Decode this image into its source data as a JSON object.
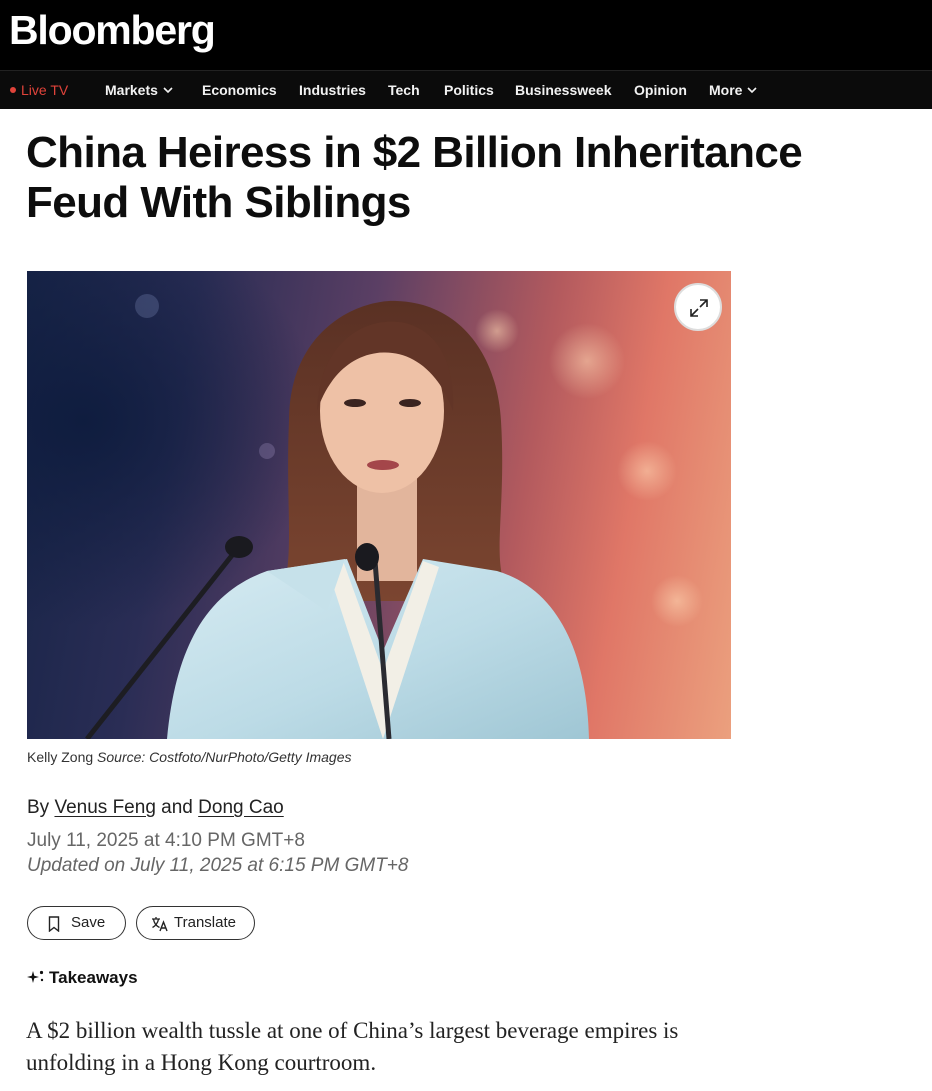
{
  "header": {
    "logo": "Bloomberg"
  },
  "nav": {
    "live": "Live TV",
    "items": [
      "Markets",
      "Economics",
      "Industries",
      "Tech",
      "Politics",
      "Businessweek",
      "Opinion",
      "More"
    ]
  },
  "article": {
    "headline_line1": "China Heiress in $2 Billion Inheritance",
    "headline_line2": "Feud With Siblings",
    "image": {
      "caption_name": "Kelly Zong",
      "caption_source": "Source: Costfoto/NurPhoto/Getty Images",
      "expand_icon": "expand-icon"
    },
    "byline": {
      "prefix": "By",
      "author1": "Venus Feng",
      "conjunction": "and",
      "author2": "Dong Cao"
    },
    "published": "July 11, 2025 at 4:10 PM GMT+8",
    "updated": "Updated on July 11, 2025 at 6:15 PM GMT+8",
    "actions": {
      "save": "Save",
      "translate": "Translate"
    },
    "takeaways_label": "Takeaways",
    "summary": "A $2 billion wealth tussle at one of China’s largest beverage empires is unfolding in a Hong Kong courtroom."
  },
  "colors": {
    "header_bg": "#000000",
    "live_red": "#e0433a",
    "text": "#111111"
  }
}
